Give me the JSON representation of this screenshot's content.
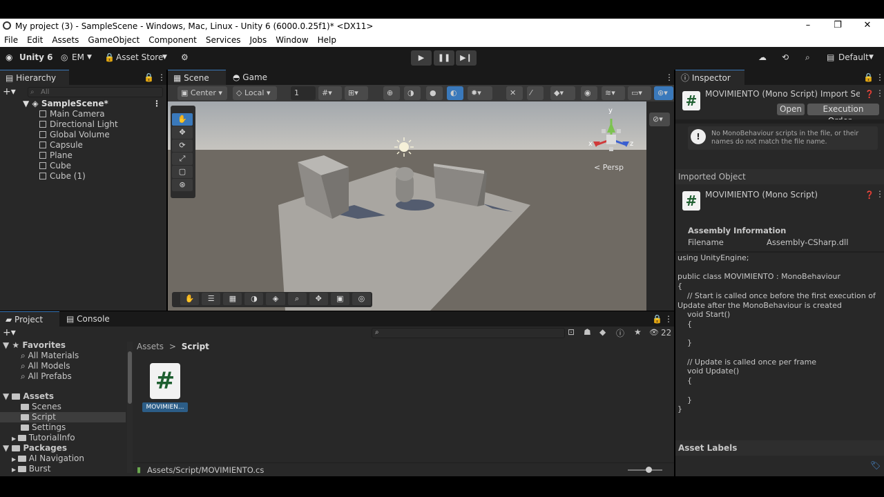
{
  "window": {
    "title": "My project (3) - SampleScene - Windows, Mac, Linux - Unity 6 (6000.0.25f1)* <DX11>",
    "minimize": "–",
    "restore": "❐",
    "close": "✕"
  },
  "menu": [
    "File",
    "Edit",
    "Assets",
    "GameObject",
    "Component",
    "Services",
    "Jobs",
    "Window",
    "Help"
  ],
  "toolbar": {
    "unity_label": "Unity 6",
    "account": "EM",
    "asset_store": "Asset Store",
    "layout": "Default"
  },
  "hierarchy": {
    "tab": "Hierarchy",
    "search_placeholder": "All",
    "scene": "SampleScene*",
    "items": [
      "Main Camera",
      "Directional Light",
      "Global Volume",
      "Capsule",
      "Plane",
      "Cube",
      "Cube (1)"
    ]
  },
  "scene": {
    "tab_scene": "Scene",
    "tab_game": "Game",
    "pivot": "Center",
    "space": "Local",
    "grid_value": "1",
    "persp": "< Persp",
    "gizmo_x": "x",
    "gizmo_y": "y",
    "gizmo_z": "z"
  },
  "inspector": {
    "tab": "Inspector",
    "title": "MOVIMIENTO (Mono Script) Import Set",
    "open_btn": "Open",
    "exec_btn": "Execution Order...",
    "warning": "No MonoBehaviour scripts in the file, or their names do not match the file name.",
    "imported_object": "Imported Object",
    "object_name": "MOVIMIENTO (Mono Script)",
    "assembly_header": "Assembly Information",
    "filename_label": "Filename",
    "filename_value": "Assembly-CSharp.dll",
    "code": "using UnityEngine;\n\npublic class MOVIMIENTO : MonoBehaviour\n{\n    // Start is called once before the first execution of\nUpdate after the MonoBehaviour is created\n    void Start()\n    {\n\n    }\n\n    // Update is called once per frame\n    void Update()\n    {\n\n    }\n}",
    "asset_labels": "Asset Labels"
  },
  "project": {
    "tab_project": "Project",
    "tab_console": "Console",
    "hidden_count": "22",
    "favorites": "Favorites",
    "fav_items": [
      "All Materials",
      "All Models",
      "All Prefabs"
    ],
    "assets": "Assets",
    "asset_folders": [
      "Scenes",
      "Script",
      "Settings",
      "TutorialInfo"
    ],
    "packages": "Packages",
    "package_items": [
      "AI Navigation",
      "Burst"
    ],
    "breadcrumb_root": "Assets",
    "breadcrumb_sep": ">",
    "breadcrumb_current": "Script",
    "file_label": "MOVIMIEN...",
    "path": "Assets/Script/MOVIMIENTO.cs"
  },
  "colors": {
    "accent": "#3a79bb",
    "panel": "#282828",
    "dark": "#191919"
  }
}
